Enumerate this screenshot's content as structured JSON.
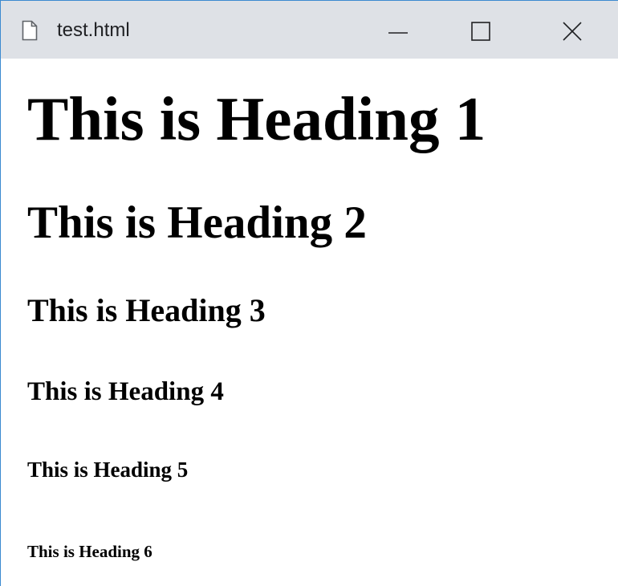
{
  "window": {
    "title": "test.html",
    "controls": {
      "minimize_icon": "minimize-icon",
      "maximize_icon": "maximize-icon",
      "close_icon": "close-icon"
    },
    "file_icon": "document-icon"
  },
  "content": {
    "headings": [
      "This is Heading 1",
      "This is Heading 2",
      "This is Heading 3",
      "This is Heading 4",
      "This is Heading 5",
      "This is Heading 6"
    ]
  },
  "colors": {
    "titlebar": "#dee1e6",
    "window_border": "#3c8ad0",
    "text": "#000000",
    "background": "#ffffff"
  }
}
